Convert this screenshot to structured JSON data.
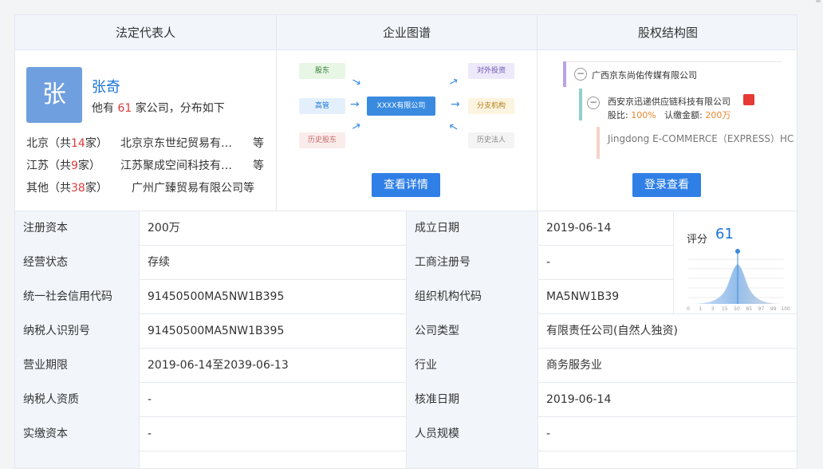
{
  "panels": {
    "legal_rep": {
      "title": "法定代表人",
      "avatar_char": "张",
      "name": "张奇",
      "summary_pre": "他有",
      "company_count": "61",
      "summary_post": "家公司，分布如下",
      "regions": [
        {
          "prefix": "北京（共",
          "count": "14",
          "suffix": "家）",
          "company": "北京京东世纪贸易有…",
          "etc": "等"
        },
        {
          "prefix": "江苏（共",
          "count": "9",
          "suffix": "家）",
          "company": "江苏聚成空间科技有…",
          "etc": "等"
        },
        {
          "prefix": "其他（共",
          "count": "38",
          "suffix": "家）",
          "company": "广州广臻贸易有限公司等",
          "etc": ""
        }
      ]
    },
    "graph": {
      "title": "企业图谱",
      "nodes": {
        "shareholder": "股东",
        "exec": "高管",
        "hist_shareholder": "历史股东",
        "center": "XXXX有限公司",
        "investment": "对外投资",
        "branch": "分支机构",
        "hist_legal": "历史法人"
      },
      "button": "查看详情"
    },
    "equity": {
      "title": "股权结构图",
      "parent": "广西京东尚佑传媒有限公司",
      "child": "西安京迅递供应链科技有限公司",
      "ratio_label": "股比:",
      "ratio_value": "100%",
      "capital_label": "认缴金额:",
      "capital_value": "200万",
      "child2": "Jingdong E-COMMERCE（EXPRESS）HC",
      "button": "登录查看"
    }
  },
  "score": {
    "label": "评分",
    "value": "61",
    "ticks": [
      "0",
      "1",
      "3",
      "15",
      "50",
      "85",
      "97",
      "99",
      "100"
    ]
  },
  "table": {
    "rows": [
      {
        "l1": "注册资本",
        "v1": "200万",
        "l2": "成立日期",
        "v2": "2019-06-14"
      },
      {
        "l1": "经营状态",
        "v1": "存续",
        "l2": "工商注册号",
        "v2": "-"
      },
      {
        "l1": "统一社会信用代码",
        "v1": "91450500MA5NW1B395",
        "l2": "组织机构代码",
        "v2": "MA5NW1B39"
      },
      {
        "l1": "纳税人识别号",
        "v1": "91450500MA5NW1B395",
        "l2": "公司类型",
        "v2": "有限责任公司(自然人独资)"
      },
      {
        "l1": "营业期限",
        "v1": "2019-06-14至2039-06-13",
        "l2": "行业",
        "v2": "商务服务业"
      },
      {
        "l1": "纳税人资质",
        "v1": "-",
        "l2": "核准日期",
        "v2": "2019-06-14"
      },
      {
        "l1": "实缴资本",
        "v1": "-",
        "l2": "人员规模",
        "v2": "-"
      }
    ]
  }
}
